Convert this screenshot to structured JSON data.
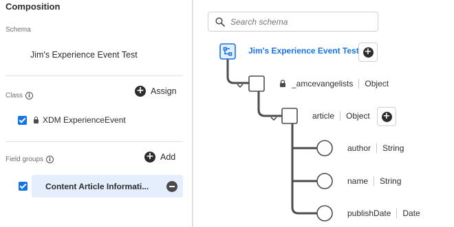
{
  "composition": {
    "title": "Composition",
    "schema_label": "Schema",
    "schema_name": "Jim's Experience Event Test",
    "class_label": "Class",
    "assign_label": "Assign",
    "class_name": "XDM ExperienceEvent",
    "field_groups_label": "Field groups",
    "add_label": "Add",
    "field_group_name": "Content Article Informati..."
  },
  "search": {
    "placeholder": "Search schema"
  },
  "tree": {
    "root": "Jim's Experience Event Test",
    "nodes": [
      {
        "name": "_amcevangelists",
        "type": "Object"
      },
      {
        "name": "article",
        "type": "Object"
      },
      {
        "name": "author",
        "type": "String"
      },
      {
        "name": "name",
        "type": "String"
      },
      {
        "name": "publishDate",
        "type": "Date"
      }
    ]
  },
  "colors": {
    "accent": "#1473e6",
    "selected_bg": "#e5eefc",
    "line": "#4b4b4b"
  },
  "icons": [
    "info-icon",
    "add-circle-icon",
    "lock-icon",
    "minus-circle-icon",
    "search-icon",
    "schema-root-icon",
    "chevron-down-icon"
  ]
}
